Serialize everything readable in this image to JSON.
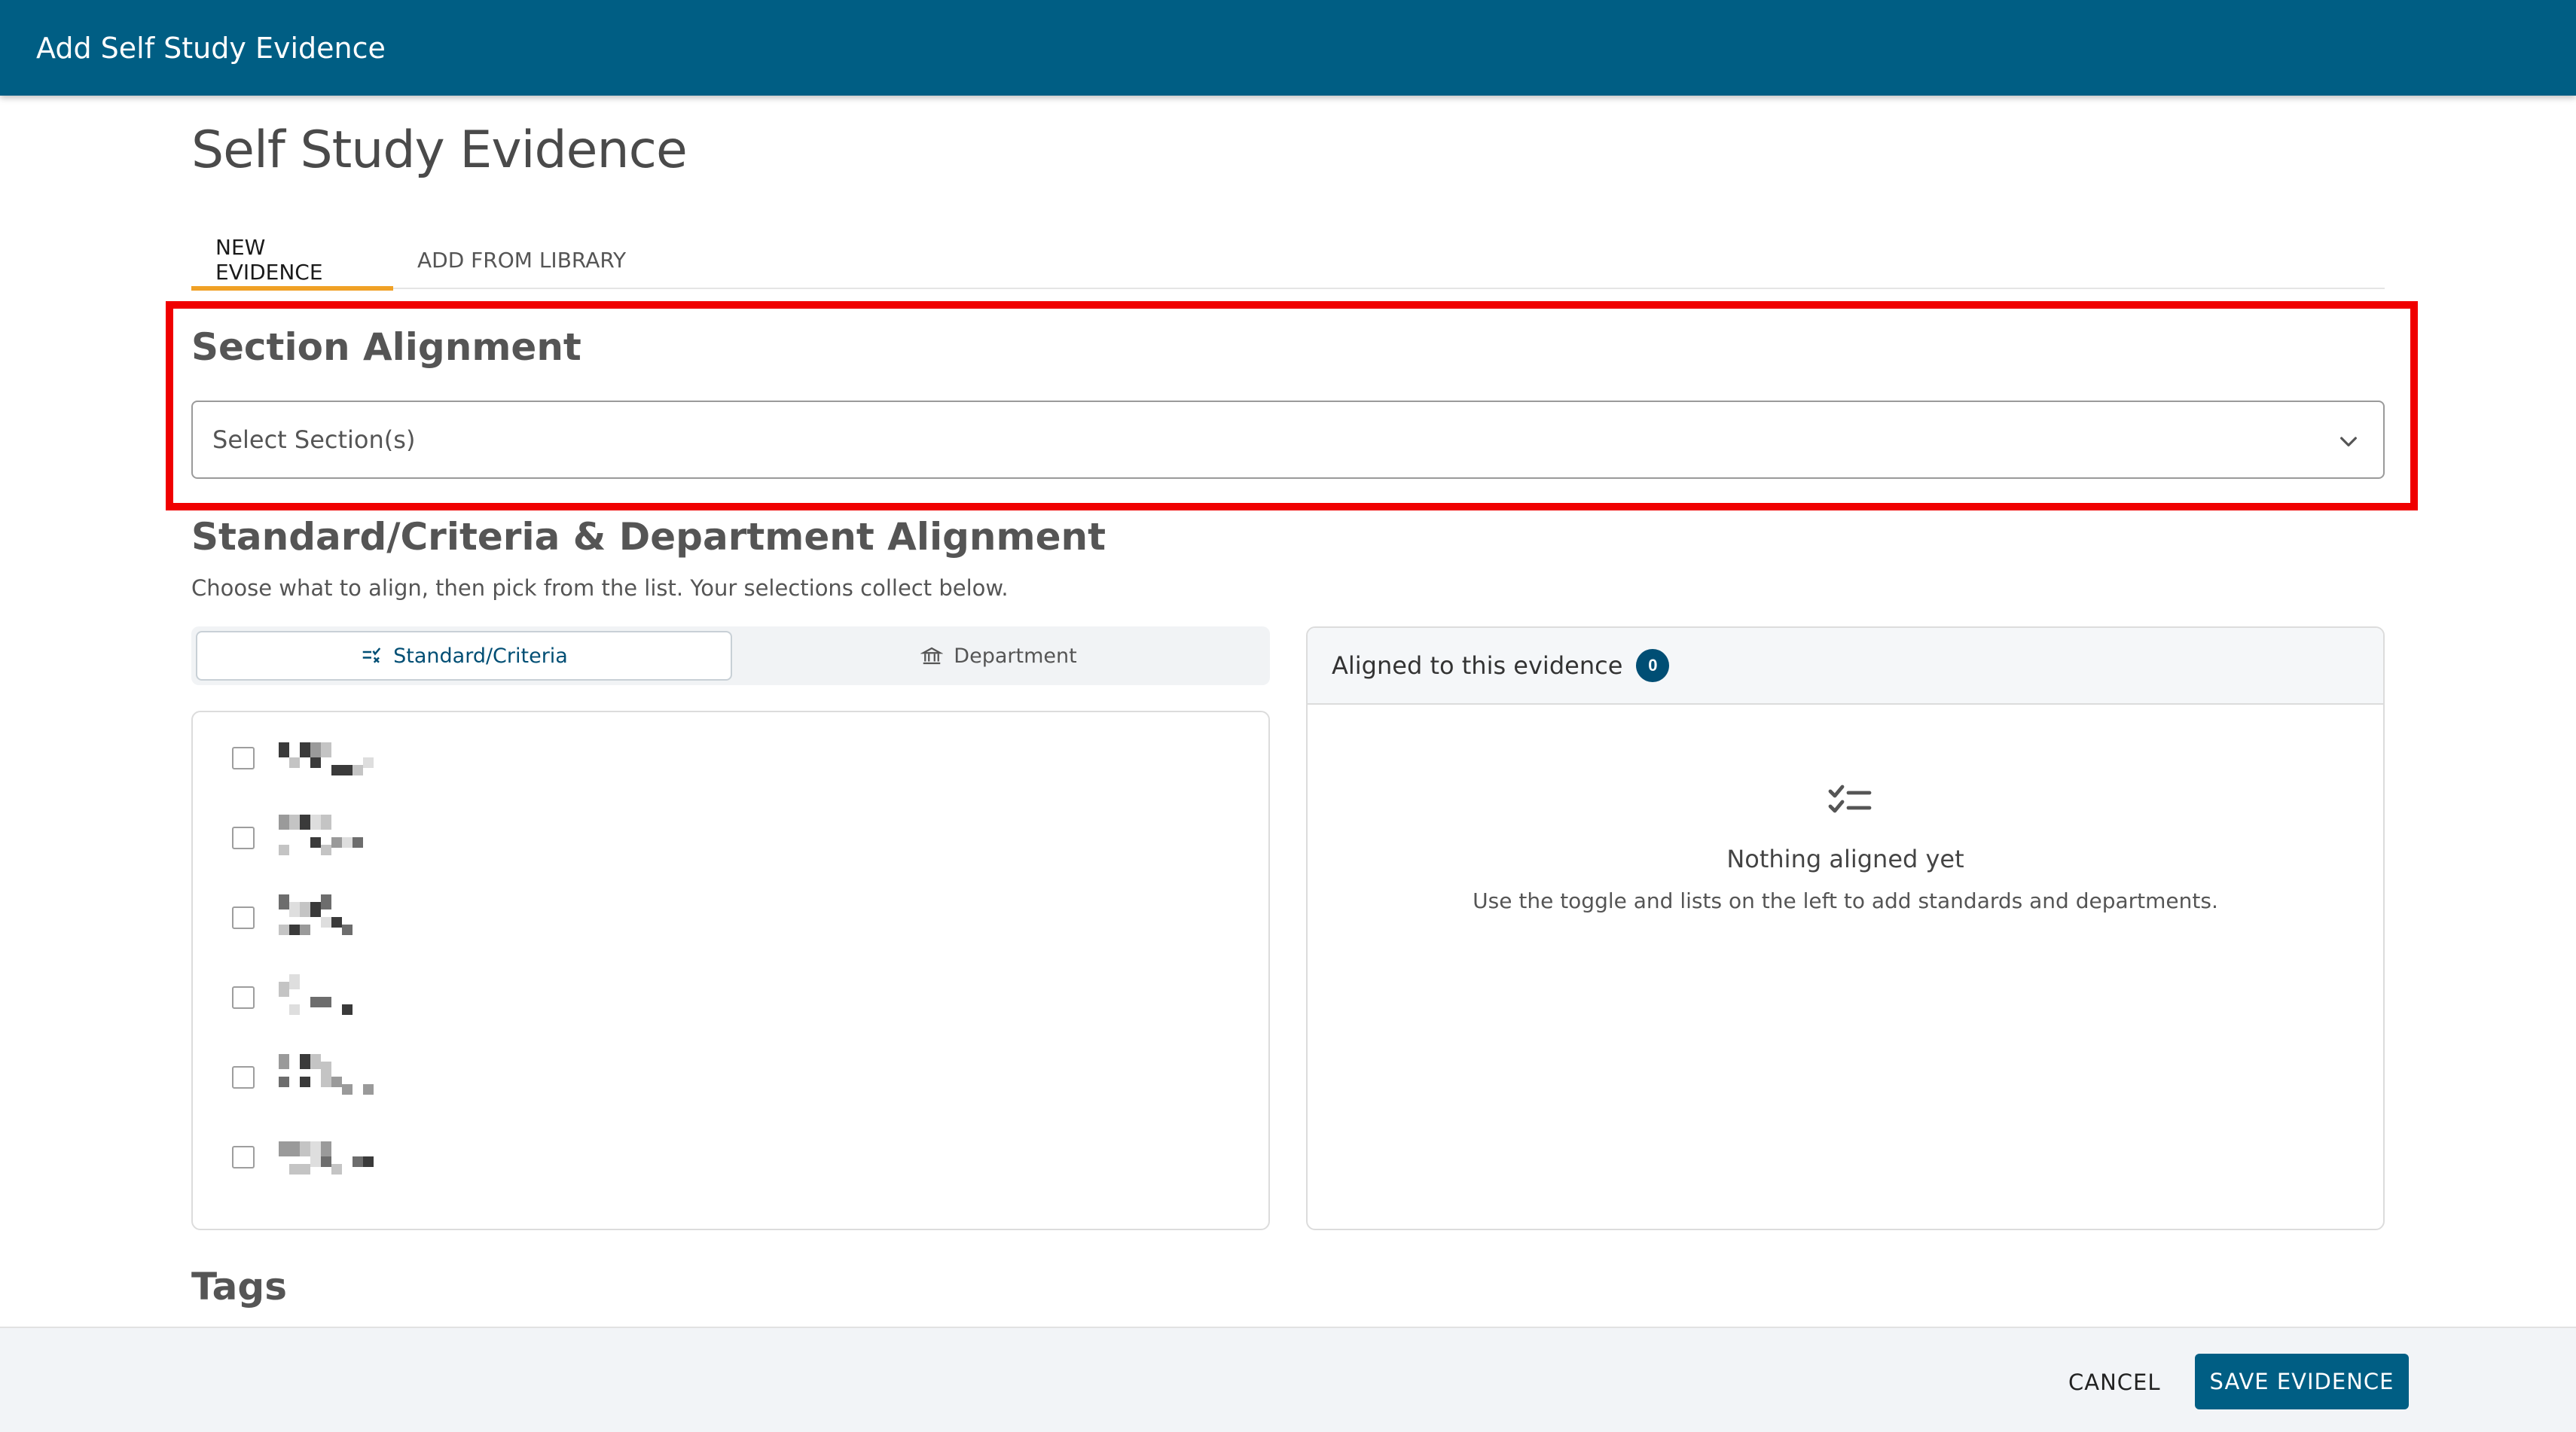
{
  "topbar": {
    "title": "Add Self Study Evidence"
  },
  "page": {
    "title": "Self Study Evidence"
  },
  "tabs": [
    {
      "label": "NEW EVIDENCE",
      "active": true
    },
    {
      "label": "ADD FROM LIBRARY",
      "active": false
    }
  ],
  "section_alignment": {
    "heading": "Section Alignment",
    "select_placeholder": "Select Section(s)"
  },
  "standard_alignment": {
    "heading": "Standard/Criteria & Department Alignment",
    "subtext": "Choose what to align, then pick from the list. Your selections collect below.",
    "toggle": {
      "standard_label": "Standard/Criteria",
      "department_label": "Department",
      "selected": "Standard/Criteria"
    },
    "list_item_count": 6
  },
  "aligned_panel": {
    "title": "Aligned to this evidence",
    "count": "0",
    "empty_title": "Nothing aligned yet",
    "empty_desc": "Use the toggle and lists on the left to add standards and departments."
  },
  "tags": {
    "heading": "Tags"
  },
  "footer": {
    "cancel_label": "CANCEL",
    "save_label": "SAVE EVIDENCE"
  },
  "colors": {
    "brand": "#005e84",
    "tab_accent": "#f0a126",
    "highlight": "#f00000",
    "badge": "#004e74"
  },
  "icons": {
    "chevron": "chevron-down-icon",
    "standard": "checklist-icon",
    "department": "building-icon",
    "empty": "checklist-icon"
  }
}
